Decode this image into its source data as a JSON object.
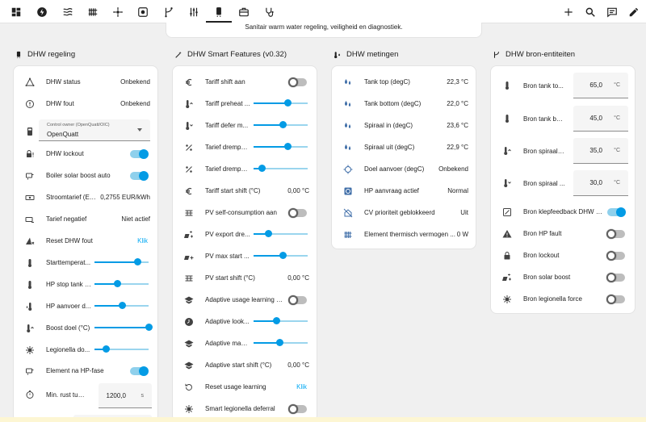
{
  "header": {
    "nav_icons": [
      "dashboard-icon",
      "lightning-icon",
      "heating-icon",
      "radiator-icon",
      "heatpump-icon",
      "controller-icon",
      "valve-icon",
      "sliders-icon",
      "water-heater-icon",
      "toolbox-icon",
      "stethoscope-icon"
    ],
    "active_tab": "water-heater-icon",
    "actions": [
      "plus-icon",
      "search-icon",
      "chat-icon",
      "pencil-icon"
    ]
  },
  "banner": {
    "text": "Sanitair warm water regeling, veiligheid en diagnostiek."
  },
  "colors": {
    "accent": "#039be5",
    "link": "#03a9f4",
    "text": "#212121",
    "muted": "#616161"
  },
  "columns": {
    "regeling": {
      "title": "DHW regeling",
      "rows": [
        {
          "label": "DHW status",
          "value": "Onbekend"
        },
        {
          "label": "DHW fout",
          "value": "Onbekend"
        },
        {
          "select_label": "Control owner (OpenQuatt/OIC)",
          "select_value": "OpenQuatt"
        },
        {
          "label": "DHW lockout",
          "toggle": "on"
        },
        {
          "label": "Boiler solar boost auto",
          "toggle": "on"
        },
        {
          "label": "Stroomtarief (EU...",
          "value": "0,2755 EUR/kWh"
        },
        {
          "label": "Tarief negatief",
          "value": "Niet actief"
        },
        {
          "label": "Reset DHW fout",
          "link": "Klik"
        },
        {
          "label": "Starttemperat...",
          "slider": 0.8
        },
        {
          "label": "HP stop tank t...",
          "slider": 0.42
        },
        {
          "label": "HP aanvoer d...",
          "slider": 0.52
        },
        {
          "label": "Boost doel (°C)",
          "slider": 1.0
        },
        {
          "label": "Legionella do...",
          "slider": 0.22
        },
        {
          "label": "Element na HP-fase",
          "toggle": "on"
        },
        {
          "label": "Min. rust tus...",
          "number": "1200,0",
          "unit": "s"
        }
      ]
    },
    "smart": {
      "title": "DHW Smart Features (v0.32)",
      "rows": [
        {
          "label": "Tariff shift aan",
          "toggle": "off"
        },
        {
          "label": "Tariff preheat ...",
          "slider": 0.63
        },
        {
          "label": "Tariff defer m...",
          "slider": 0.55
        },
        {
          "label": "Tarief drempel...",
          "slider": 0.63
        },
        {
          "label": "Tarief drempel...",
          "slider": 0.16
        },
        {
          "label": "Tariff start shift (°C)",
          "value": "0,00 °C"
        },
        {
          "label": "PV self-consumption aan",
          "toggle": "off"
        },
        {
          "label": "PV export dre...",
          "slider": 0.28
        },
        {
          "label": "PV max start ...",
          "slider": 0.55
        },
        {
          "label": "PV start shift (°C)",
          "value": "0,00 °C"
        },
        {
          "label": "Adaptive usage learning aan",
          "toggle": "off"
        },
        {
          "label": "Adaptive look...",
          "slider": 0.42
        },
        {
          "label": "Adaptive max ...",
          "slider": 0.48
        },
        {
          "label": "Adaptive start shift (°C)",
          "value": "0,00 °C"
        },
        {
          "label": "Reset usage learning",
          "link": "Klik"
        },
        {
          "label": "Smart legionella deferral",
          "toggle": "off"
        }
      ]
    },
    "metingen": {
      "title": "DHW metingen",
      "rows": [
        {
          "label": "Tank top (degC)",
          "value": "22,3 °C"
        },
        {
          "label": "Tank bottom (degC)",
          "value": "22,0 °C"
        },
        {
          "label": "Spiraal in (degC)",
          "value": "23,6 °C"
        },
        {
          "label": "Spiraal uit (degC)",
          "value": "22,9 °C"
        },
        {
          "label": "Doel aanvoer (degC)",
          "value": "Onbekend"
        },
        {
          "label": "HP aanvraag actief",
          "value": "Normal"
        },
        {
          "label": "CV prioriteit geblokkeerd",
          "value": "Uit"
        },
        {
          "label": "Element thermisch vermogen ...",
          "value": "0 W"
        }
      ]
    },
    "bron": {
      "title": "DHW bron-entiteiten",
      "rows": [
        {
          "label": "Bron tank to...",
          "number": "65,0",
          "unit": "°C"
        },
        {
          "label": "Bron tank bo...",
          "number": "45,0",
          "unit": "°C"
        },
        {
          "label": "Bron spiraal i...",
          "number": "35,0",
          "unit": "°C"
        },
        {
          "label": "Bron spiraal ...",
          "number": "30,0",
          "unit": "°C"
        },
        {
          "label": "Bron klepfeedback DHW (a...",
          "toggle": "on"
        },
        {
          "label": "Bron HP fault",
          "toggle": "off"
        },
        {
          "label": "Bron lockout",
          "toggle": "off"
        },
        {
          "label": "Bron solar boost",
          "toggle": "off"
        },
        {
          "label": "Bron legionella force",
          "toggle": "off"
        }
      ]
    }
  }
}
